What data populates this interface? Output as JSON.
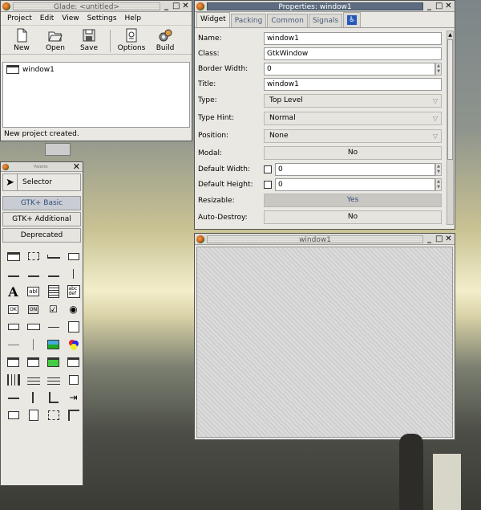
{
  "glade": {
    "title": "Glade: <untitled>",
    "menu": [
      "Project",
      "Edit",
      "View",
      "Settings",
      "Help"
    ],
    "toolbar": {
      "new": "New",
      "open": "Open",
      "save": "Save",
      "options": "Options",
      "build": "Build"
    },
    "tree_item": "window1",
    "status": "New project created."
  },
  "palette": {
    "title": "Palette",
    "selector": "Selector",
    "tabs": [
      "GTK+ Basic",
      "GTK+ Additional",
      "Deprecated"
    ],
    "icon_labels": {
      "text_a": "A",
      "entry": "abl",
      "textview": "abc def",
      "ok": "OK",
      "on": "ON"
    }
  },
  "properties": {
    "title": "Properties: window1",
    "tabs": [
      "Widget",
      "Packing",
      "Common",
      "Signals"
    ],
    "rows": {
      "name": {
        "label": "Name:",
        "value": "window1"
      },
      "class": {
        "label": "Class:",
        "value": "GtkWindow"
      },
      "border_width": {
        "label": "Border Width:",
        "value": "0"
      },
      "title": {
        "label": "Title:",
        "value": "window1"
      },
      "type": {
        "label": "Type:",
        "value": "Top Level"
      },
      "type_hint": {
        "label": "Type Hint:",
        "value": "Normal"
      },
      "position": {
        "label": "Position:",
        "value": "None"
      },
      "modal": {
        "label": "Modal:",
        "value": "No"
      },
      "default_width": {
        "label": "Default Width:",
        "value": "0"
      },
      "default_height": {
        "label": "Default Height:",
        "value": "0"
      },
      "resizable": {
        "label": "Resizable:",
        "value": "Yes"
      },
      "auto_destroy": {
        "label": "Auto-Destroy:",
        "value": "No"
      }
    }
  },
  "window1": {
    "title": "window1"
  },
  "wm": {
    "minimize": "_",
    "maximize": "□",
    "close": "✕"
  }
}
